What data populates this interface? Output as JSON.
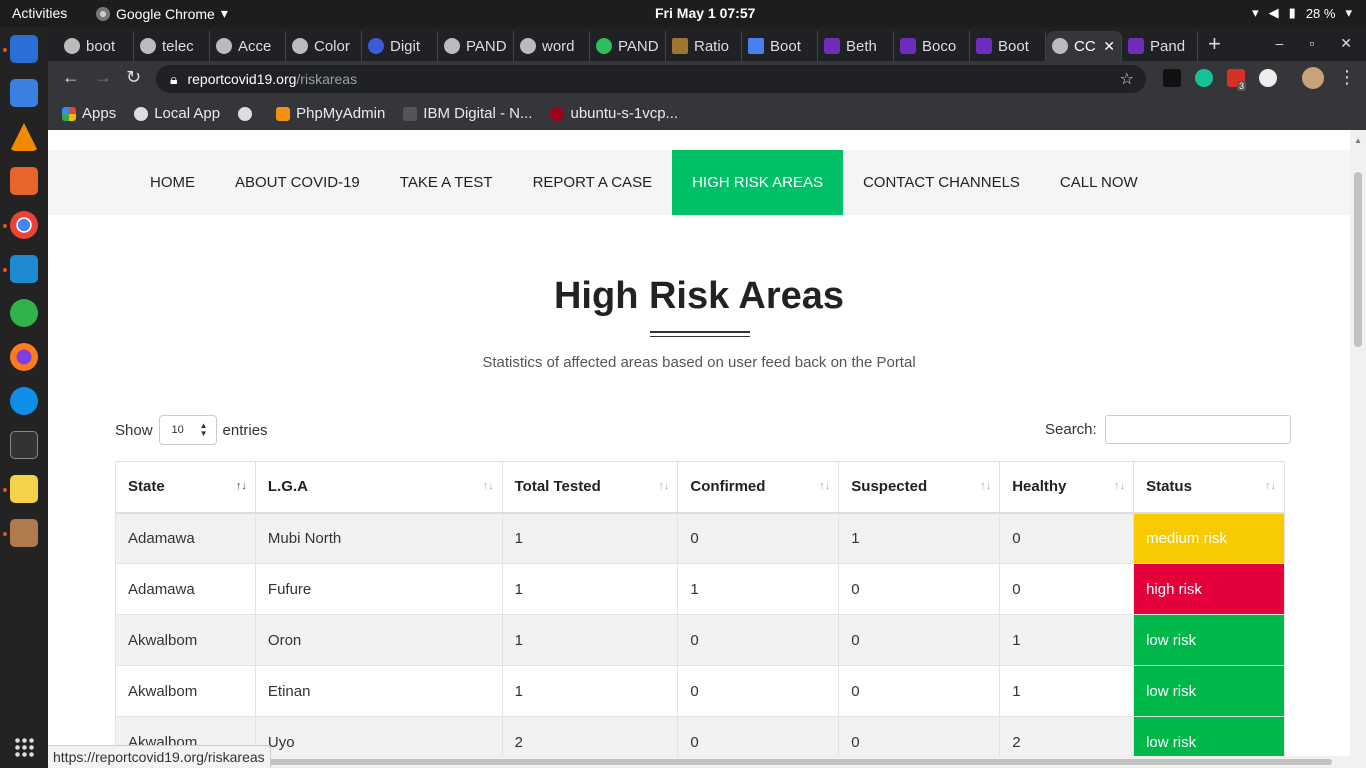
{
  "topbar": {
    "activities": "Activities",
    "app_name": "Google Chrome",
    "clock": "Fri May 1  07:57",
    "battery": "28 %"
  },
  "chrome": {
    "tabs": [
      {
        "title": "boot"
      },
      {
        "title": "telec"
      },
      {
        "title": "Acce"
      },
      {
        "title": "Color"
      },
      {
        "title": "Digit"
      },
      {
        "title": "PAND"
      },
      {
        "title": "word"
      },
      {
        "title": "PAND"
      },
      {
        "title": "Ratio"
      },
      {
        "title": "Boot"
      },
      {
        "title": "Beth"
      },
      {
        "title": "Boco"
      },
      {
        "title": "Boot"
      },
      {
        "title": "CC"
      },
      {
        "title": "Pand"
      }
    ],
    "url_host": "reportcovid19.org",
    "url_path": "/riskareas",
    "bookmarks": [
      {
        "label": "Apps"
      },
      {
        "label": "Local App"
      },
      {
        "label": ""
      },
      {
        "label": "PhpMyAdmin"
      },
      {
        "label": "IBM Digital - N..."
      },
      {
        "label": "ubuntu-s-1vcp..."
      }
    ],
    "ext_badge": "3"
  },
  "nav": {
    "items": [
      "HOME",
      "ABOUT COVID-19",
      "TAKE A TEST",
      "REPORT A CASE",
      "HIGH RISK AREAS",
      "CONTACT CHANNELS",
      "CALL NOW"
    ]
  },
  "main": {
    "title": "High Risk Areas",
    "subtitle": "Statistics of affected areas based on user feed back on the Portal",
    "show_label": "Show",
    "entries_value": "10",
    "entries_label": "entries",
    "search_label": "Search:"
  },
  "table": {
    "headers": [
      "State",
      "L.G.A",
      "Total Tested",
      "Confirmed",
      "Suspected",
      "Healthy",
      "Status"
    ],
    "rows": [
      [
        "Adamawa",
        "Mubi North",
        "1",
        "0",
        "1",
        "0",
        "medium risk"
      ],
      [
        "Adamawa",
        "Fufure",
        "1",
        "1",
        "0",
        "0",
        "high risk"
      ],
      [
        "Akwalbom",
        "Oron",
        "1",
        "0",
        "0",
        "1",
        "low risk"
      ],
      [
        "Akwalbom",
        "Etinan",
        "1",
        "0",
        "0",
        "1",
        "low risk"
      ],
      [
        "Akwalbom",
        "Uyo",
        "2",
        "0",
        "0",
        "2",
        "low risk"
      ]
    ]
  },
  "status_bar_url": "https://reportcovid19.org/riskareas",
  "colors": {
    "accent": "#00c167",
    "medium_risk": "#f7cb00",
    "high_risk": "#e4003a",
    "low_risk": "#00b84a"
  }
}
